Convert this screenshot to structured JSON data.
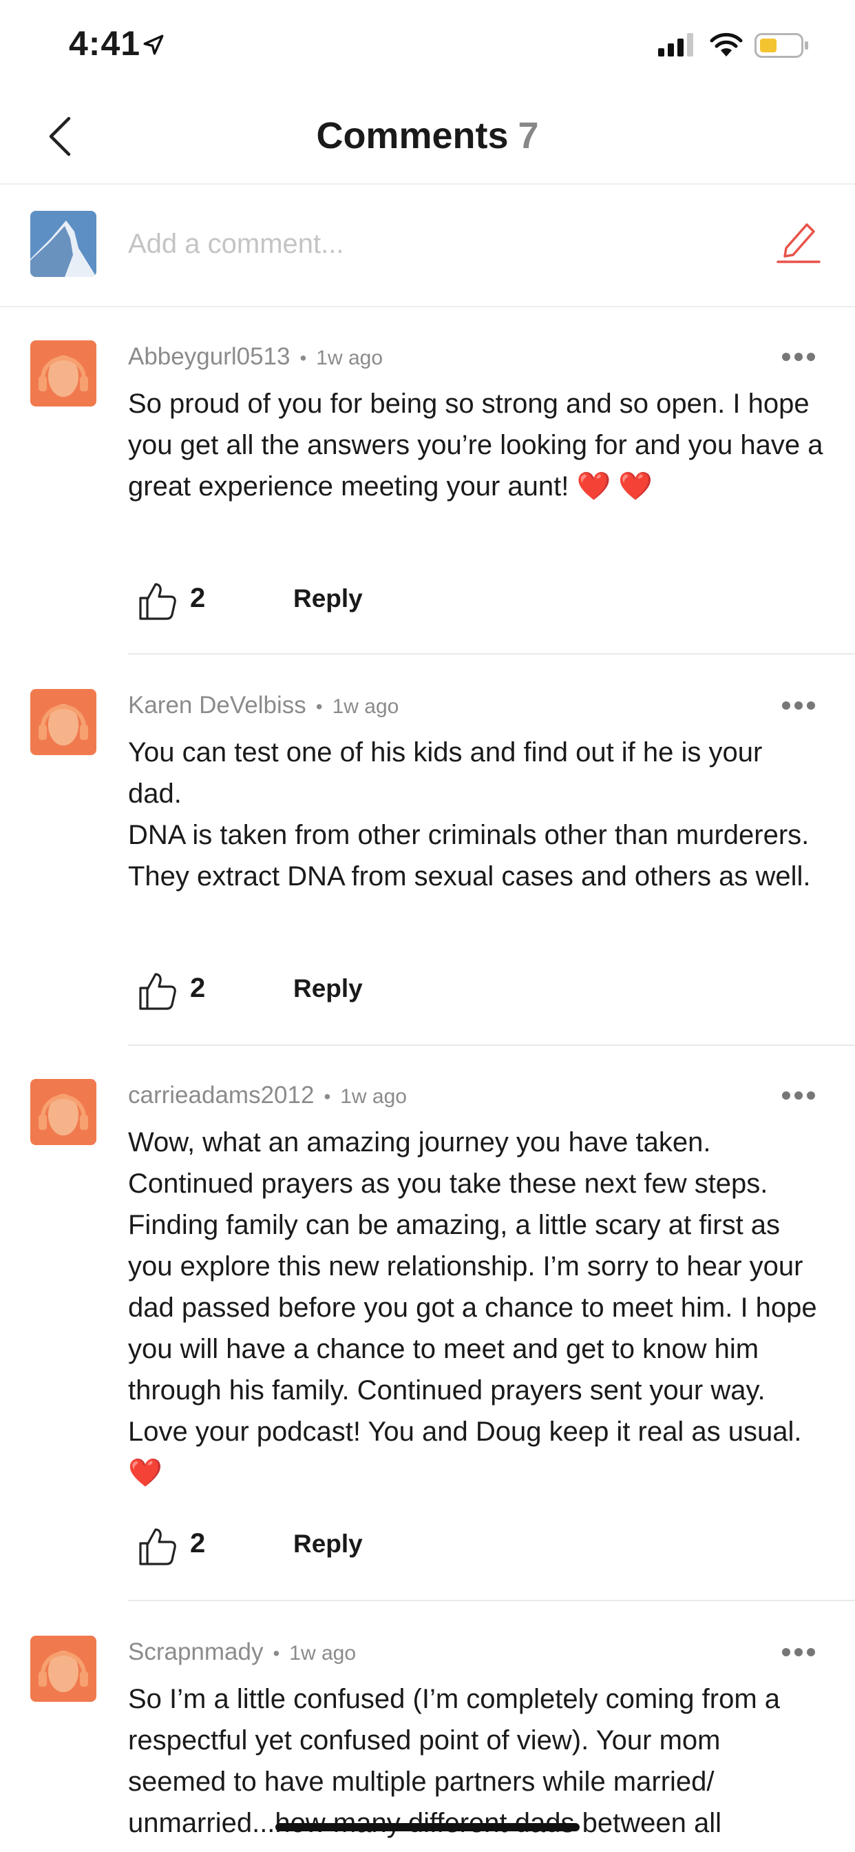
{
  "status_bar": {
    "time": "4:41"
  },
  "header": {
    "title": "Comments",
    "count": "7"
  },
  "compose": {
    "placeholder": "Add a comment..."
  },
  "comments": [
    {
      "username": "Abbeygurl0513",
      "time": "1w ago",
      "text": "So proud of you for being so strong and so open. I hope you get all the answers you’re looking for and you have a great experience meeting your aunt! ❤️ ❤️",
      "likes": "2",
      "reply_label": "Reply"
    },
    {
      "username": "Karen DeVelbiss",
      "time": "1w ago",
      "text": "You can test one of his kids and find out if he is your dad.\nDNA is taken from other criminals other than murderers. They extract DNA from sexual cases and others as well.",
      "likes": "2",
      "reply_label": "Reply"
    },
    {
      "username": "carrieadams2012",
      "time": "1w ago",
      "text": "Wow, what an amazing journey you have taken. Continued prayers as you take these next few steps.  Finding family can be amazing, a little scary at first as you explore this new relationship. I’m sorry to hear your dad passed before you got a chance to meet him. I hope you will have a chance to meet and get to know him through his family. Continued prayers sent your way. Love your podcast! You and Doug keep it real as usual. ❤️",
      "likes": "2",
      "reply_label": "Reply"
    },
    {
      "username": "Scrapnmady",
      "time": "1w ago",
      "text": "So I’m a little confused (I’m completely coming from a respectful yet confused point of view). Your mom seemed to have multiple partners while married/ unmarried...how many different dads between all",
      "likes": "",
      "reply_label": ""
    }
  ],
  "colors": {
    "accent": "#e8534a",
    "avatar_orange": "#f07a4e",
    "meta_gray": "#8b8b8b"
  }
}
